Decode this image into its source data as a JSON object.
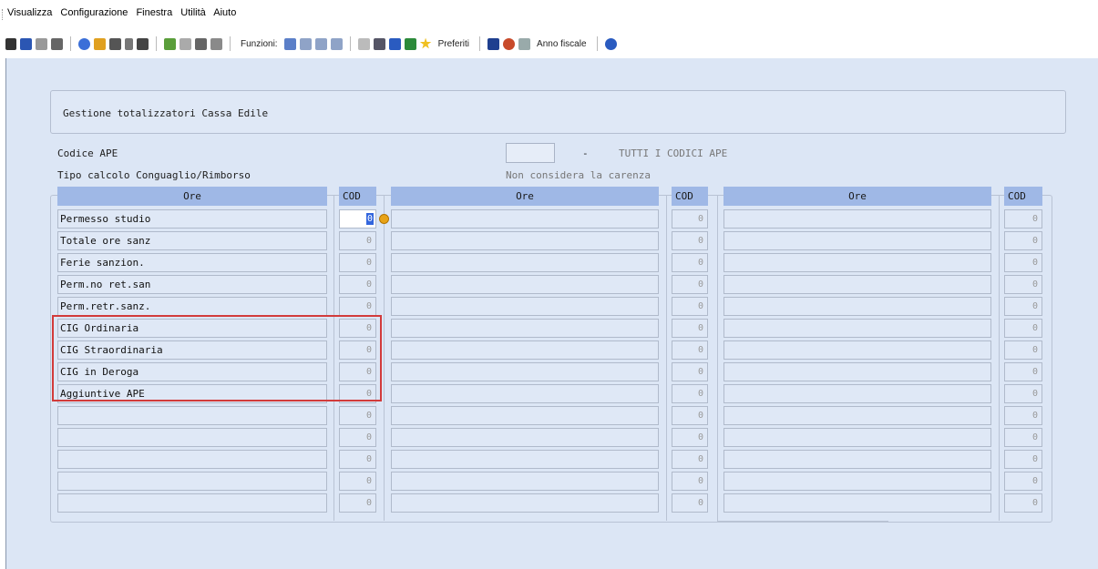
{
  "menu": {
    "items": [
      "Visualizza",
      "Configurazione",
      "Finestra",
      "Utilità",
      "Aiuto"
    ]
  },
  "toolbar": {
    "funzioni_label": "Funzioni:",
    "preferiti_label": "Preferiti",
    "anno_label": "Anno fiscale"
  },
  "form": {
    "title": "Gestione totalizzatori Cassa Edile",
    "codice_ape_label": "Codice APE",
    "codice_ape_value": "",
    "dash": "-",
    "codice_ape_desc": "TUTTI I CODICI APE",
    "tipo_calcolo_label": "Tipo calcolo Conguaglio/Rimborso",
    "tipo_calcolo_value": "Non considera la carenza"
  },
  "grid": {
    "headers": {
      "ore1": "Ore",
      "cod1": "COD",
      "ore2": "Ore",
      "cod2": "COD",
      "ore3": "Ore",
      "cod3": "COD"
    },
    "rows": [
      {
        "label": "Permesso studio",
        "cod1": "0",
        "cod2": "0",
        "cod3": "0"
      },
      {
        "label": "Totale ore sanz",
        "cod1": "0",
        "cod2": "0",
        "cod3": "0"
      },
      {
        "label": "Ferie sanzion.",
        "cod1": "0",
        "cod2": "0",
        "cod3": "0"
      },
      {
        "label": "Perm.no ret.san",
        "cod1": "0",
        "cod2": "0",
        "cod3": "0"
      },
      {
        "label": "Perm.retr.sanz.",
        "cod1": "0",
        "cod2": "0",
        "cod3": "0"
      },
      {
        "label": "CIG Ordinaria",
        "cod1": "0",
        "cod2": "0",
        "cod3": "0"
      },
      {
        "label": "CIG Straordinaria",
        "cod1": "0",
        "cod2": "0",
        "cod3": "0"
      },
      {
        "label": "CIG in Deroga",
        "cod1": "0",
        "cod2": "0",
        "cod3": "0"
      },
      {
        "label": "Aggiuntive APE",
        "cod1": "0",
        "cod2": "0",
        "cod3": "0"
      },
      {
        "label": "",
        "cod1": "0",
        "cod2": "0",
        "cod3": "0"
      },
      {
        "label": "",
        "cod1": "0",
        "cod2": "0",
        "cod3": "0"
      },
      {
        "label": "",
        "cod1": "0",
        "cod2": "0",
        "cod3": "0"
      },
      {
        "label": "",
        "cod1": "0",
        "cod2": "0",
        "cod3": "0"
      },
      {
        "label": "",
        "cod1": "0",
        "cod2": "0",
        "cod3": "0"
      }
    ]
  }
}
